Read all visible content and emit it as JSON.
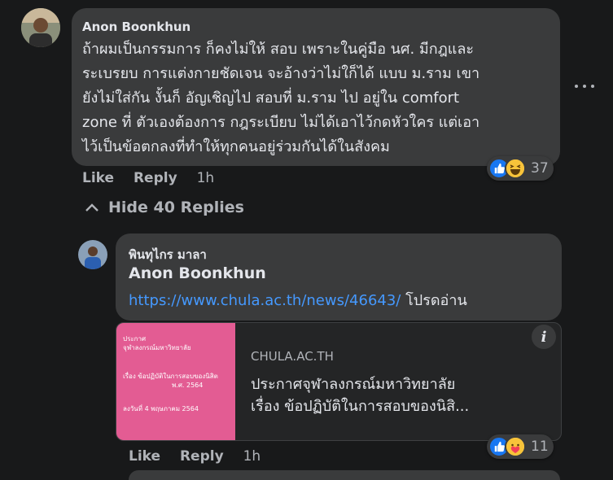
{
  "comment": {
    "author": "Anon Boonkhun",
    "lines": [
      "ถ้าผมเป็นกรรมการ ก็คงไม่ให้ สอบ เพราะในคู่มือ นศ. มีกฎและ",
      "ระเบรยบ การแต่งกายชัดเจน จะอ้างว่าไม่ใก็ได้ แบบ ม.ราม เขา",
      "ยังไม่ใส่กัน งั้นก็ อัญเชิญไป สอบที่ ม.ราม ไป อยู่ใน comfort",
      "zone ที่ ตัวเองต้องการ กฎระเบียบ ไม่ได้เอาไว้กดหัวใคร แต่เอา",
      "ไว้เป็นข้อตกลงที่ทำให้ทุกคนอยู่ร่วมกันได้ในสังคม"
    ],
    "actions": {
      "like": "Like",
      "reply": "Reply",
      "time": "1h"
    },
    "reaction_count": "37",
    "reaction_icons": [
      "like-icon",
      "haha-icon"
    ],
    "hide_replies": "Hide 40 Replies",
    "more_icon": "more-horizontal-icon"
  },
  "reply": {
    "author": "พินทุไกร มาลา",
    "mention": "Anon Boonkhun",
    "link": "https://www.chula.ac.th/news/46643/",
    "text_after_link": " โปรดอ่าน",
    "preview": {
      "image_lines": [
        "ประกาศ",
        "จุฬาลงกรณ์มหาวิทยาลัย",
        "เรื่อง ข้อปฏิบัติในการสอบของนิสิต",
        "พ.ศ. 2564",
        "ลงวันที่ 4 พฤษภาคม 2564"
      ],
      "domain": "CHULA.AC.TH",
      "title_line1": "ประกาศจุฬาลงกรณ์มหาวิทยาลัย",
      "title_line2": "เรื่อง ข้อปฏิบัติในการสอบของนิสิ...",
      "info_icon": "info-icon"
    },
    "actions": {
      "like": "Like",
      "reply": "Reply",
      "time": "1h"
    },
    "reaction_count": "11",
    "reaction_icons": [
      "like-icon",
      "care-icon"
    ]
  },
  "colors": {
    "background": "#18191a",
    "bubble": "#3a3b3c",
    "link": "#4599ff",
    "secondary_text": "#b0b3b8",
    "preview_image": "#e35c93"
  }
}
